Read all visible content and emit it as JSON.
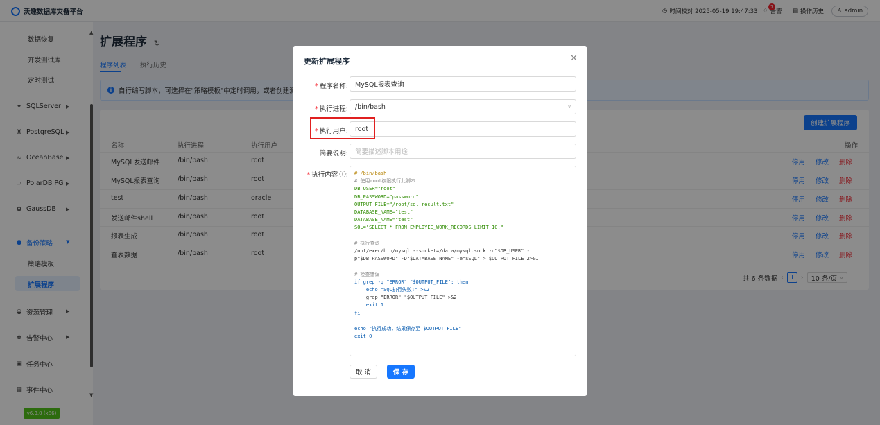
{
  "app": {
    "title": "沃趣数据库灾备平台",
    "accent": "#1677ff"
  },
  "topbar": {
    "time_label": "时间校对 2025-05-19 19:47:33",
    "alerts_label": "告警",
    "alerts_badge": "7",
    "history_label": "操作历史",
    "user": "admin"
  },
  "sidebar": {
    "subitems_top": [
      "数据恢复",
      "开发测试库",
      "定时测试"
    ],
    "groups": [
      {
        "label": "SQLServer",
        "icon": "sqlserver-icon"
      },
      {
        "label": "PostgreSQL",
        "icon": "postgresql-icon"
      },
      {
        "label": "OceanBase",
        "icon": "oceanbase-icon"
      },
      {
        "label": "PolarDB PG",
        "icon": "polardb-icon"
      },
      {
        "label": "GaussDB",
        "icon": "gaussdb-icon"
      },
      {
        "label": "备份策略",
        "icon": "backup-policy-icon"
      },
      {
        "label": "资源管理",
        "icon": "resource-icon"
      },
      {
        "label": "告警中心",
        "icon": "alarm-icon"
      },
      {
        "label": "任务中心",
        "icon": "task-icon"
      },
      {
        "label": "事件中心",
        "icon": "event-icon"
      }
    ],
    "policy_children": [
      "策略模板",
      "扩展程序"
    ],
    "version": "v6.3.0 (x86)"
  },
  "page": {
    "title": "扩展程序",
    "tabs": [
      "程序列表",
      "执行历史"
    ],
    "alert": "自行编写脚本，可选择在\"策略模板\"中定时调用，或者创建测",
    "create_button": "创建扩展程序"
  },
  "table": {
    "columns": [
      "名称",
      "执行进程",
      "执行用户",
      "操作"
    ],
    "rows": [
      {
        "name": "MySQL发送邮件",
        "process": "/bin/bash",
        "user": "root"
      },
      {
        "name": "MySQL报表查询",
        "process": "/bin/bash",
        "user": "root"
      },
      {
        "name": "test",
        "process": "/bin/bash",
        "user": "oracle"
      },
      {
        "name": "发送邮件shell",
        "process": "/bin/bash",
        "user": "root"
      },
      {
        "name": "报表生成",
        "process": "/bin/bash",
        "user": "root"
      },
      {
        "name": "查表数据",
        "process": "/bin/bash",
        "user": "root"
      }
    ],
    "actions": [
      "停用",
      "修改",
      "删除"
    ],
    "total": "共 6 条数据",
    "page": "1",
    "page_size": "10 条/页"
  },
  "modal": {
    "title": "更新扩展程序",
    "fields": {
      "name_label": "程序名称:",
      "name_value": "MySQL报表查询",
      "process_label": "执行进程:",
      "process_value": "/bin/bash",
      "user_label": "执行用户:",
      "user_value": "root",
      "desc_label": "简要说明:",
      "desc_placeholder": "简要描述脚本用途",
      "content_label": "执行内容"
    },
    "code_lines": [
      "#!/bin/bash",
      "# 使用root权限执行此脚本",
      "DB_USER=\"root\"",
      "DB_PASSWORD=\"password\"",
      "OUTPUT_FILE=\"/root/sql_result.txt\"",
      "DATABASE_NAME=\"test\"",
      "DATABASE_NAME=\"test\"",
      "SQL=\"SELECT * FROM EMPLOYEE_WORK_RECORDS LIMIT 10;\"",
      "",
      "# 执行查询",
      "/opt/exec/bin/mysql --socket=/data/mysql.sock -u\"$DB_USER\" -",
      "p\"$DB_PASSWORD\" -D\"$DATABASE_NAME\" -e\"$SQL\" > $OUTPUT_FILE 2>&1",
      "",
      "# 检查错误",
      "if grep -q \"ERROR\" \"$OUTPUT_FILE\"; then",
      "    echo \"SQL执行失败:\" >&2",
      "    grep \"ERROR\" \"$OUTPUT_FILE\" >&2",
      "    exit 1",
      "fi",
      "",
      "echo \"执行成功，结果保存至 $OUTPUT_FILE\"",
      "exit 0"
    ],
    "cancel": "取 消",
    "save": "保 存"
  }
}
